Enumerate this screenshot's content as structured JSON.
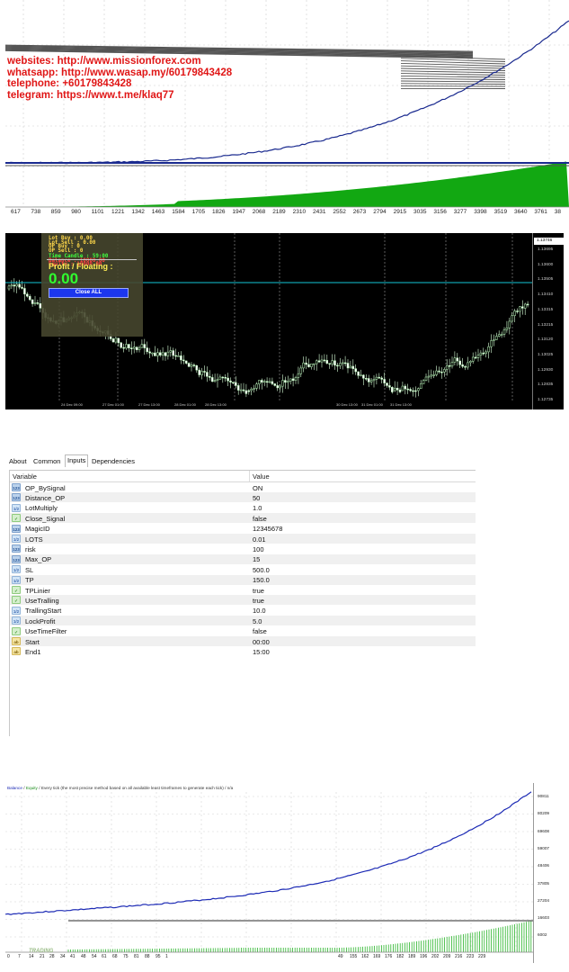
{
  "panel1": {
    "contact_lines": [
      "websites: http://www.missionforex.com",
      "whatsapp: http://www.wasap.my/60179843428",
      "telephone: +60179843428",
      "telegram: https://www.t.me/klaq77"
    ],
    "x_axis_labels": [
      "617",
      "738",
      "859",
      "980",
      "1101",
      "1221",
      "1342",
      "1463",
      "1584",
      "1705",
      "1826",
      "1947",
      "2068",
      "2189",
      "2310",
      "2431",
      "2552",
      "2673",
      "2794",
      "2915",
      "3035",
      "3156",
      "3277",
      "3398",
      "3519",
      "3640",
      "3761",
      "38"
    ]
  },
  "panel2": {
    "hud_lines": [
      {
        "text": "Lot Buy     : 0.00",
        "color": "y"
      },
      {
        "text": "Lot Sell    : 0.00",
        "color": "y"
      },
      {
        "text": "OP Buy      : 0",
        "color": "y"
      },
      {
        "text": "OP Sell     : 0",
        "color": "y"
      },
      {
        "text": "Time Candle : 59:00",
        "color": "g"
      },
      {
        "text": "Balance     : 10000.00",
        "color": "r"
      },
      {
        "text": "Equity      : 10000.00",
        "color": "r"
      }
    ],
    "profit_label": "Profit / Floating  :",
    "profit_value": "0.00",
    "close_all_label": "Close ALL",
    "current_price": "1.13746",
    "price_labels": [
      "1.13695",
      "1.13600",
      "1.13505",
      "1.13410",
      "1.13315",
      "1.13215",
      "1.13120",
      "1.13025",
      "1.12930",
      "1.12835",
      "1.12735"
    ],
    "time_labels": [
      "24 Dec 09:00",
      "27 Dec 01:00",
      "27 Dec 13:00",
      "28 Dec 01:00",
      "28 Dec 13:00",
      "30 Dec 13:00",
      "31 Dec 01:00",
      "31 Dec 13:00"
    ]
  },
  "panel3": {
    "tabs": [
      "About",
      "Common",
      "Inputs",
      "Dependencies"
    ],
    "active_tab": "Inputs",
    "columns": {
      "variable": "Variable",
      "value": "Value"
    },
    "rows": [
      {
        "type": "int",
        "name": "OP_BySignal",
        "value": "ON"
      },
      {
        "type": "int",
        "name": "Distance_OP",
        "value": "50"
      },
      {
        "type": "dbl",
        "name": "LotMultiply",
        "value": "1.0"
      },
      {
        "type": "bool",
        "name": "Close_Signal",
        "value": "false"
      },
      {
        "type": "int",
        "name": "MagicID",
        "value": "12345678"
      },
      {
        "type": "dbl",
        "name": "LOTS",
        "value": "0.01"
      },
      {
        "type": "int",
        "name": "risk",
        "value": "100"
      },
      {
        "type": "int",
        "name": "Max_OP",
        "value": "15"
      },
      {
        "type": "dbl",
        "name": "SL",
        "value": "500.0"
      },
      {
        "type": "dbl",
        "name": "TP",
        "value": "150.0"
      },
      {
        "type": "bool",
        "name": "TPLinier",
        "value": "true"
      },
      {
        "type": "bool",
        "name": "UseTralling",
        "value": "true"
      },
      {
        "type": "dbl",
        "name": "TrallingStart",
        "value": "10.0"
      },
      {
        "type": "dbl",
        "name": "LockProfit",
        "value": "5.0"
      },
      {
        "type": "bool",
        "name": "UseTimeFilter",
        "value": "false"
      },
      {
        "type": "str",
        "name": "Start",
        "value": "00:00"
      },
      {
        "type": "str",
        "name": "End1",
        "value": "15:00"
      }
    ],
    "icon_text": {
      "int": "123",
      "dbl": "1/2",
      "bool": "✓",
      "str": "ab"
    }
  },
  "panel4": {
    "title_balance": "Balance",
    "title_sep": " / ",
    "title_equity": "Equity",
    "title_rest": " / Every tick (the most precise method based on all available least timeframes to generate each tick) / n/a",
    "y_labels": [
      "90811",
      "80209",
      "69608",
      "59007",
      "48406",
      "37805",
      "27204",
      "16603",
      "6002"
    ],
    "x_labels": [
      "0",
      "7",
      "14",
      "21",
      "28",
      "34",
      "41",
      "48",
      "54",
      "61",
      "68",
      "75",
      "81",
      "88",
      "95",
      "1",
      "49",
      "155",
      "162",
      "169",
      "176",
      "182",
      "189",
      "196",
      "202",
      "209",
      "216",
      "223",
      "229"
    ],
    "watermark": "TRADING"
  }
}
